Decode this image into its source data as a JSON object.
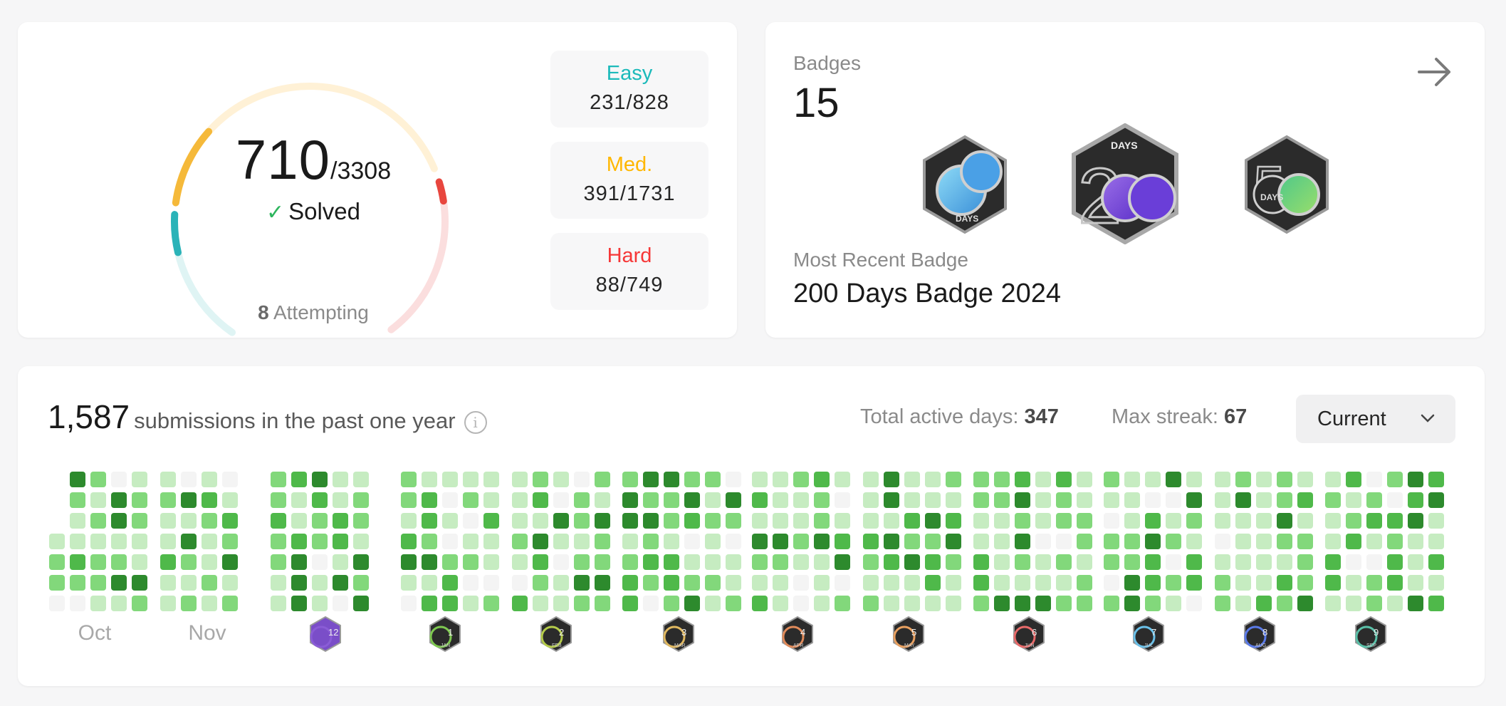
{
  "progress": {
    "solved": "710",
    "total": "/3308",
    "solved_label": "Solved",
    "attempting_count": "8",
    "attempting_label": "Attempting",
    "difficulties": [
      {
        "label": "Easy",
        "value": "231/828",
        "color": "#1cbaba"
      },
      {
        "label": "Med.",
        "value": "391/1731",
        "color": "#ffb700"
      },
      {
        "label": "Hard",
        "value": "88/749",
        "color": "#f63737"
      }
    ],
    "ring_fractions": {
      "easy": 0.279,
      "medium": 0.226,
      "hard": 0.118
    }
  },
  "badges": {
    "label": "Badges",
    "count": "15",
    "shown": [
      {
        "icon": "100-days-badge-icon",
        "text": "DAYS"
      },
      {
        "icon": "200-days-badge-icon",
        "text": "DAYS"
      },
      {
        "icon": "50-days-badge-icon",
        "text": "DAYS"
      }
    ],
    "recent_label": "Most Recent Badge",
    "recent_name": "200 Days Badge 2024"
  },
  "activity": {
    "count": "1,587",
    "title_suffix": "submissions in the past one year",
    "active_days_label": "Total active days:",
    "active_days": "347",
    "max_streak_label": "Max streak:",
    "max_streak": "67",
    "dropdown_value": "Current",
    "months": [
      {
        "type": "text",
        "label": "Oct"
      },
      {
        "type": "text",
        "label": "Nov"
      },
      {
        "type": "badge",
        "num": "12",
        "abbr": "",
        "color": "#8a5cd6"
      },
      {
        "type": "badge",
        "num": "1",
        "abbr": "JAN",
        "color": "#7ec850"
      },
      {
        "type": "badge",
        "num": "2",
        "abbr": "FEB",
        "color": "#b5cc4a"
      },
      {
        "type": "badge",
        "num": "3",
        "abbr": "MAR",
        "color": "#e0b860"
      },
      {
        "type": "badge",
        "num": "4",
        "abbr": "APR",
        "color": "#e08a5a"
      },
      {
        "type": "badge",
        "num": "5",
        "abbr": "MAY",
        "color": "#e8a060"
      },
      {
        "type": "badge",
        "num": "6",
        "abbr": "JUN",
        "color": "#e86a6a"
      },
      {
        "type": "badge",
        "num": "7",
        "abbr": "JUL",
        "color": "#6ac0e8"
      },
      {
        "type": "badge",
        "num": "8",
        "abbr": "AUG",
        "color": "#5a7ae8"
      },
      {
        "type": "badge",
        "num": "9",
        "abbr": "SEP",
        "color": "#5ac0a8"
      }
    ],
    "colors": [
      "#f4f4f4",
      "#c6ecc1",
      "#82d87b",
      "#4fb94a",
      "#2d8a2d"
    ]
  }
}
